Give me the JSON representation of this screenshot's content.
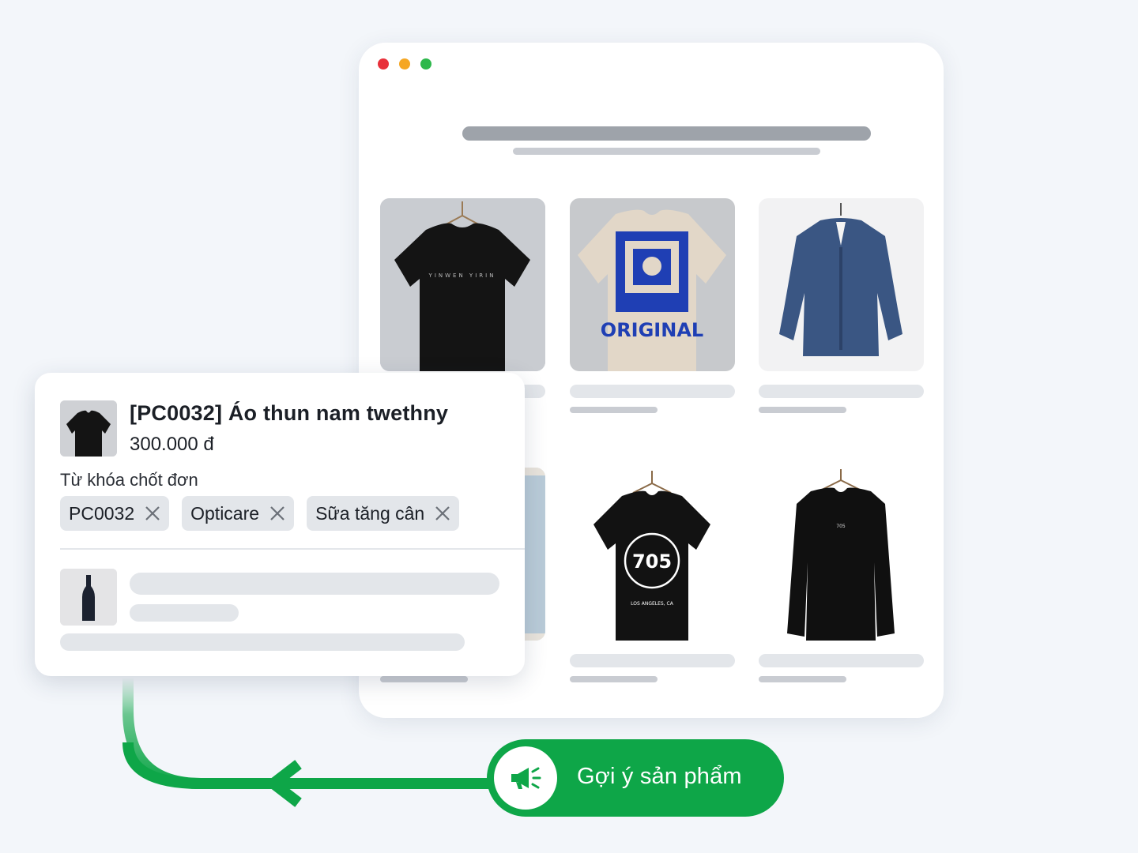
{
  "browser": {
    "window_controls": [
      "close",
      "minimize",
      "maximize"
    ],
    "products": [
      {
        "image": "black-tshirt-on-hanger-icon"
      },
      {
        "image": "beige-graphic-tshirt-original-icon"
      },
      {
        "image": "navy-button-shirt-icon"
      },
      {
        "image": "light-jeans-icon"
      },
      {
        "image": "black-tshirt-705-icon",
        "print_text": "705"
      },
      {
        "image": "black-longsleeve-icon",
        "print_text": "705"
      }
    ]
  },
  "popup": {
    "product_title": "[PC0032] Áo thun nam twethny",
    "product_price": "300.000 đ",
    "keywords_label": "Từ khóa chốt đơn",
    "tags": [
      "PC0032",
      "Opticare",
      "Sữa tăng cân"
    ]
  },
  "cta": {
    "label": "Gợi ý sản phẩm",
    "icon": "megaphone-icon"
  },
  "colors": {
    "accent": "#0ea648",
    "background": "#f3f6fa"
  }
}
